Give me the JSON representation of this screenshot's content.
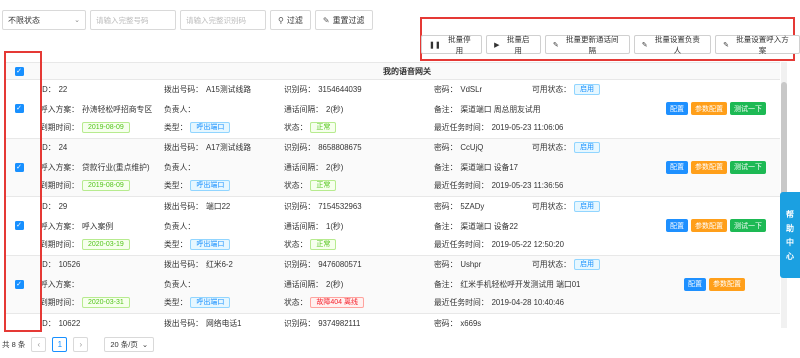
{
  "filters": {
    "status_select": "不限状态",
    "code_placeholder": "请输入完整号码",
    "id_placeholder": "请输入完整识别码",
    "filter_label": "过滤",
    "reset_label": "重置过滤"
  },
  "batch": {
    "disable": "批量停用",
    "enable": "批量启用",
    "update_interval": "批量更新通话间隔",
    "set_owner": "批量设置负责人",
    "set_plan": "批量设置呼入方案"
  },
  "table": {
    "title": "我的语音网关",
    "labels": {
      "id": "ID：",
      "plan": "呼入方案：",
      "expire": "到期时间：",
      "out_number": "拨出号码：",
      "owner": "负责人：",
      "type": "类型：",
      "code": "识别码：",
      "interval": "通话间隔：",
      "status": "状态：",
      "password": "密码：",
      "remark": "备注：",
      "last_task": "最近任务时间：",
      "available": "可用状态："
    },
    "rows": [
      {
        "id": "22",
        "plan": "孙涛轻松呼招商专区",
        "expire": "2019-08-09",
        "out_number": "A15测试线路",
        "owner": "",
        "type": "呼出端口",
        "code": "3154644039",
        "interval": "2(秒)",
        "status": "正常",
        "password": "VdSLr",
        "remark": "渠道端口 周总朋友试用",
        "last_task": "2019-05-23 11:06:06",
        "available": "启用",
        "btn_config": "配置",
        "btn_param": "参数配置",
        "btn_test": "测试一下"
      },
      {
        "id": "24",
        "plan": "贷款行业(重点维护)",
        "expire": "2019-08-09",
        "out_number": "A17测试线路",
        "owner": "",
        "type": "呼出端口",
        "code": "8658808675",
        "interval": "2(秒)",
        "status": "正常",
        "password": "CcUjQ",
        "remark": "渠道端口 设备17",
        "last_task": "2019-05-23 11:36:56",
        "available": "启用",
        "btn_config": "配置",
        "btn_param": "参数配置",
        "btn_test": "测试一下"
      },
      {
        "id": "29",
        "plan": "呼入案例",
        "expire": "2020-03-19",
        "out_number": "端口22",
        "owner": "",
        "type": "呼出端口",
        "code": "7154532963",
        "interval": "1(秒)",
        "status": "正常",
        "password": "5ZADy",
        "remark": "渠道端口 设备22",
        "last_task": "2019-05-22 12:50:20",
        "available": "启用",
        "btn_config": "配置",
        "btn_param": "参数配置",
        "btn_test": "测试一下"
      },
      {
        "id": "10526",
        "plan": "",
        "expire": "2020-03-31",
        "out_number": "红米6-2",
        "owner": "",
        "type": "呼出端口",
        "code": "9476080571",
        "interval": "2(秒)",
        "status": "故障404 离线",
        "password": "Ushpr",
        "remark": "红米手机轻松呼开发测试用 端口01",
        "last_task": "2019-04-28 10:40:46",
        "available": "启用",
        "btn_config": "配置",
        "btn_param": "参数配置"
      },
      {
        "id": "10622",
        "out_number": "网络电话1",
        "code": "9374982111",
        "password": "x669s"
      }
    ]
  },
  "help": {
    "chars": [
      "帮",
      "助",
      "中",
      "心"
    ]
  },
  "pager": {
    "total": "共 8 条",
    "prev": "‹",
    "current": "1",
    "next": "›",
    "size": "20 条/页"
  }
}
